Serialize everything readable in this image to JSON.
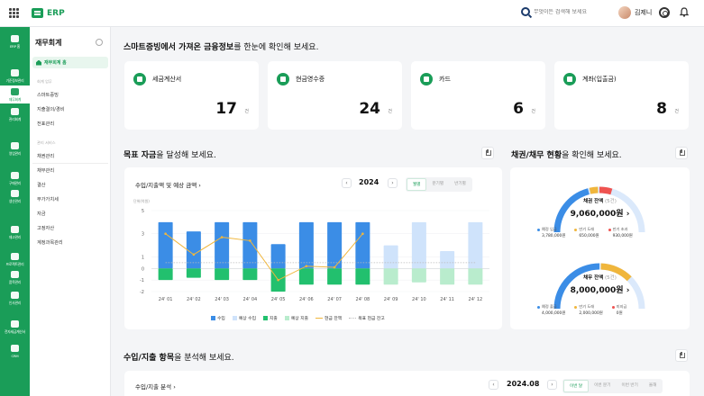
{
  "topbar": {
    "app_name": "ERP",
    "search_placeholder": "무엇이든 검색해 보세요",
    "user_name": "김제니"
  },
  "rail": {
    "items": [
      {
        "label": "ERP 홈",
        "icon": "home-icon"
      },
      {
        "label": "기준정보관리",
        "icon": "database-icon"
      },
      {
        "label": "재무회계",
        "icon": "ledger-icon"
      },
      {
        "label": "관리회계",
        "icon": "pie-icon"
      },
      {
        "label": "영업관리",
        "icon": "handshake-icon"
      },
      {
        "label": "구매관리",
        "icon": "cart-icon"
      },
      {
        "label": "생산관리",
        "icon": "factory-icon"
      },
      {
        "label": "재고관리",
        "icon": "box-icon"
      },
      {
        "label": "프로젝트관리",
        "icon": "project-icon"
      },
      {
        "label": "품목관리",
        "icon": "list-icon"
      },
      {
        "label": "인사관리",
        "icon": "person-icon"
      },
      {
        "label": "전자세금계산서",
        "icon": "invoice-icon"
      },
      {
        "label": "CRM",
        "icon": "crm-icon"
      }
    ],
    "active_index": 2
  },
  "subnav": {
    "title": "재무회계",
    "home_label": "재무회계 홈",
    "section1": "회계 업무",
    "section1_items": [
      "스마트증빙",
      "지출결의/경비",
      "전표관리"
    ],
    "section2": "관리 서비스",
    "section2_items": [
      "채권관리",
      "채무관리",
      "결산",
      "부가가치세",
      "자금",
      "고정자산",
      "계정과목관리"
    ]
  },
  "summary": {
    "title_bold": "스마트증빙에서 가져온 금융정보",
    "title_rest": "를 한눈에 확인해 보세요.",
    "cards": [
      {
        "name": "세금계산서",
        "value": "17",
        "unit": "건"
      },
      {
        "name": "현금영수증",
        "value": "24",
        "unit": "건"
      },
      {
        "name": "카드",
        "value": "6",
        "unit": "건"
      },
      {
        "name": "계좌(입출금)",
        "value": "8",
        "unit": "건"
      }
    ]
  },
  "goal": {
    "title_bold": "목표 자금",
    "title_rest": "을 달성해 보세요.",
    "card_title": "수입/지출액 및 예상 금액",
    "year": "2024",
    "segments": [
      "월별",
      "분기별",
      "반기별"
    ],
    "segment_active": 0,
    "unit_label": "단위(억원)",
    "legend": [
      "수입",
      "예상 수입",
      "지출",
      "예상 지출",
      "현금 잔액",
      "목표 현금 잔고"
    ]
  },
  "chart_data": {
    "type": "bar",
    "categories": [
      "24' 01",
      "24' 02",
      "24' 03",
      "24' 04",
      "24' 05",
      "24' 06",
      "24' 07",
      "24' 08",
      "24' 09",
      "24' 10",
      "24' 11",
      "24' 12"
    ],
    "ylim": [
      -2,
      5
    ],
    "yticks": [
      5,
      3,
      1,
      0,
      -1,
      -2
    ],
    "series": [
      {
        "name": "수입",
        "values": [
          4,
          3.2,
          4,
          4,
          2.1,
          4,
          4,
          4,
          null,
          null,
          null,
          null
        ]
      },
      {
        "name": "예상 수입",
        "values": [
          null,
          null,
          null,
          null,
          null,
          null,
          null,
          null,
          2,
          4,
          1.5,
          4
        ]
      },
      {
        "name": "지출",
        "values": [
          -1,
          -0.8,
          -1,
          -1,
          -2,
          -1.4,
          -1.4,
          -1.4,
          null,
          null,
          null,
          null
        ]
      },
      {
        "name": "예상 지출",
        "values": [
          null,
          null,
          null,
          null,
          null,
          null,
          null,
          null,
          -1.4,
          -1.2,
          -1.4,
          -1.4
        ]
      },
      {
        "name": "현금 잔액",
        "values": [
          3,
          1.2,
          2.7,
          2.4,
          -1,
          0.2,
          0.1,
          3,
          null,
          null,
          null,
          null
        ]
      },
      {
        "name": "목표 현금 잔고",
        "values": [
          0.5,
          0.5,
          0.5,
          0.5,
          0.5,
          0.5,
          0.5,
          0.5,
          0.5,
          0.5,
          0.5,
          0.5
        ]
      }
    ],
    "colors": {
      "income": "#3b8de6",
      "expected_income": "#cfe3fb",
      "expense": "#22c06e",
      "expected_expense": "#b9eccd",
      "cash": "#f0b63c",
      "target": "#bbbbbb"
    }
  },
  "debt": {
    "title_bold": "채권/채무 현황",
    "title_rest": "을 확인해 보세요.",
    "receivable": {
      "label": "채권 잔액",
      "count": "(5건)",
      "amount": "9,060,000원",
      "legend": [
        {
          "label": "예정 입금",
          "value": "3,780,000원",
          "color": "#3b8de6"
        },
        {
          "label": "만기 도래",
          "value": "650,000원",
          "color": "#f0b63c"
        },
        {
          "label": "만기 초과",
          "value": "930,000원",
          "color": "#ef5350"
        }
      ]
    },
    "payable": {
      "label": "채무 잔액",
      "count": "(5건)",
      "amount": "8,000,000원",
      "legend": [
        {
          "label": "예정 출금",
          "value": "4,000,000원",
          "color": "#3b8de6"
        },
        {
          "label": "만기 도래",
          "value": "2,000,000원",
          "color": "#f0b63c"
        },
        {
          "label": "미지급",
          "value": "0원",
          "color": "#ef5350"
        }
      ]
    }
  },
  "analysis": {
    "title_bold": "수입/지출 항목",
    "title_rest": "을 분석해 보세요.",
    "card_title": "수입/지출 분석",
    "period": "2024.08",
    "segments": [
      "이번 달",
      "이번 분기",
      "이번 반기",
      "올해"
    ],
    "segment_active": 0
  }
}
